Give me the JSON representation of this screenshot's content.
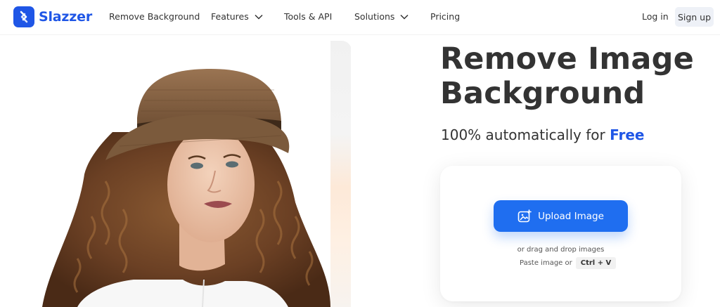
{
  "header": {
    "logo_text": "Slazzer",
    "nav": [
      {
        "label": "Remove Background",
        "has_dropdown": false
      },
      {
        "label": "Features",
        "has_dropdown": true
      },
      {
        "label": "Tools & API",
        "has_dropdown": false
      },
      {
        "label": "Solutions",
        "has_dropdown": true
      },
      {
        "label": "Pricing",
        "has_dropdown": false
      }
    ],
    "login_label": "Log in",
    "signup_label": "Sign up"
  },
  "hero": {
    "image_alt": "woman-with-hat-photo",
    "title_line1": "Remove Image",
    "title_line2": "Background",
    "subtitle_prefix": "100% automatically for",
    "subtitle_highlight": "Free"
  },
  "upload": {
    "button_label": "Upload Image",
    "drag_text": "or drag and drop images",
    "paste_text": "Paste image or",
    "shortcut": "Ctrl + V"
  },
  "colors": {
    "brand": "#1f56e6",
    "button": "#1f6ef0",
    "text": "#333333"
  }
}
